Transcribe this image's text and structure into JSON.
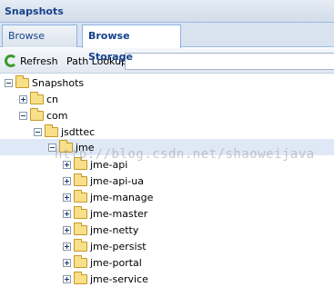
{
  "panel": {
    "title": "Snapshots"
  },
  "tabs": [
    {
      "label": "Browse Index",
      "active": false
    },
    {
      "label": "Browse Storage",
      "active": true
    }
  ],
  "toolbar": {
    "refresh_label": "Refresh",
    "path_lookup_label": "Path Lookup:",
    "path_lookup_value": ""
  },
  "tree": {
    "nodes": [
      {
        "label": "Snapshots",
        "expanded": true
      },
      {
        "label": "cn",
        "expanded": false
      },
      {
        "label": "com",
        "expanded": true
      },
      {
        "label": "jsdttec",
        "expanded": true
      },
      {
        "label": "jme",
        "expanded": true,
        "selected": true
      },
      {
        "label": "jme-api",
        "expanded": false
      },
      {
        "label": "jme-api-ua",
        "expanded": false
      },
      {
        "label": "jme-manage",
        "expanded": false
      },
      {
        "label": "jme-master",
        "expanded": false
      },
      {
        "label": "jme-netty",
        "expanded": false
      },
      {
        "label": "jme-persist",
        "expanded": false
      },
      {
        "label": "jme-portal",
        "expanded": false
      },
      {
        "label": "jme-service",
        "expanded": false
      }
    ]
  },
  "watermark": "http://blog.csdn.net/shaoweijava"
}
